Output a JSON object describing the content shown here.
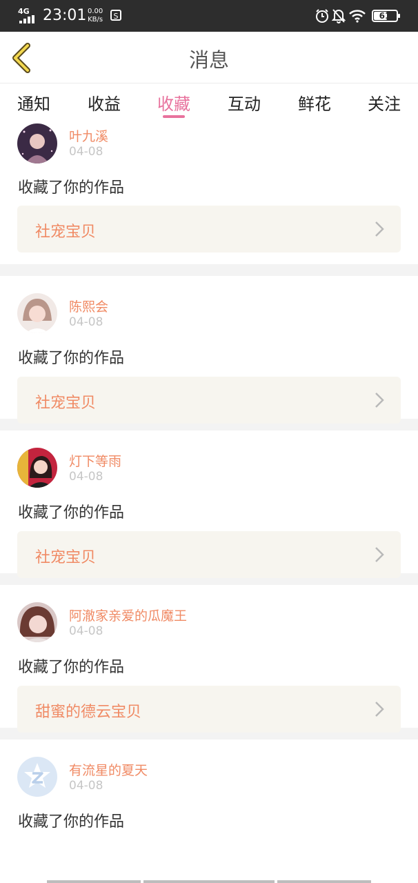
{
  "status_bar": {
    "network": "4G",
    "time": "23:01",
    "speed_value": "0.00",
    "speed_unit": "KB/s",
    "s_icon": "S",
    "battery": "61",
    "battery_level": 0.61
  },
  "header": {
    "title": "消息"
  },
  "tabs": [
    {
      "label": "通知"
    },
    {
      "label": "收益"
    },
    {
      "label": "收藏",
      "active": true
    },
    {
      "label": "互动"
    },
    {
      "label": "鲜花"
    },
    {
      "label": "关注"
    }
  ],
  "feed": [
    {
      "user": "叶九溪",
      "date": "04-08",
      "action": "收藏了你的作品",
      "work": "社宠宝贝"
    },
    {
      "user": "陈熙会",
      "date": "04-08",
      "action": "收藏了你的作品",
      "work": "社宠宝贝"
    },
    {
      "user": "灯下等雨",
      "date": "04-08",
      "action": "收藏了你的作品",
      "work": "社宠宝贝"
    },
    {
      "user": "阿澈家亲爱的瓜魔王",
      "date": "04-08",
      "action": "收藏了你的作品",
      "work": "甜蜜的德云宝贝"
    },
    {
      "user": "有流星的夏天",
      "date": "04-08",
      "action": "收藏了你的作品"
    }
  ],
  "colors": {
    "accent": "#e8729d",
    "username": "#f08a64",
    "work_title": "#f08a64",
    "status_bar": "#2d2d2d"
  }
}
